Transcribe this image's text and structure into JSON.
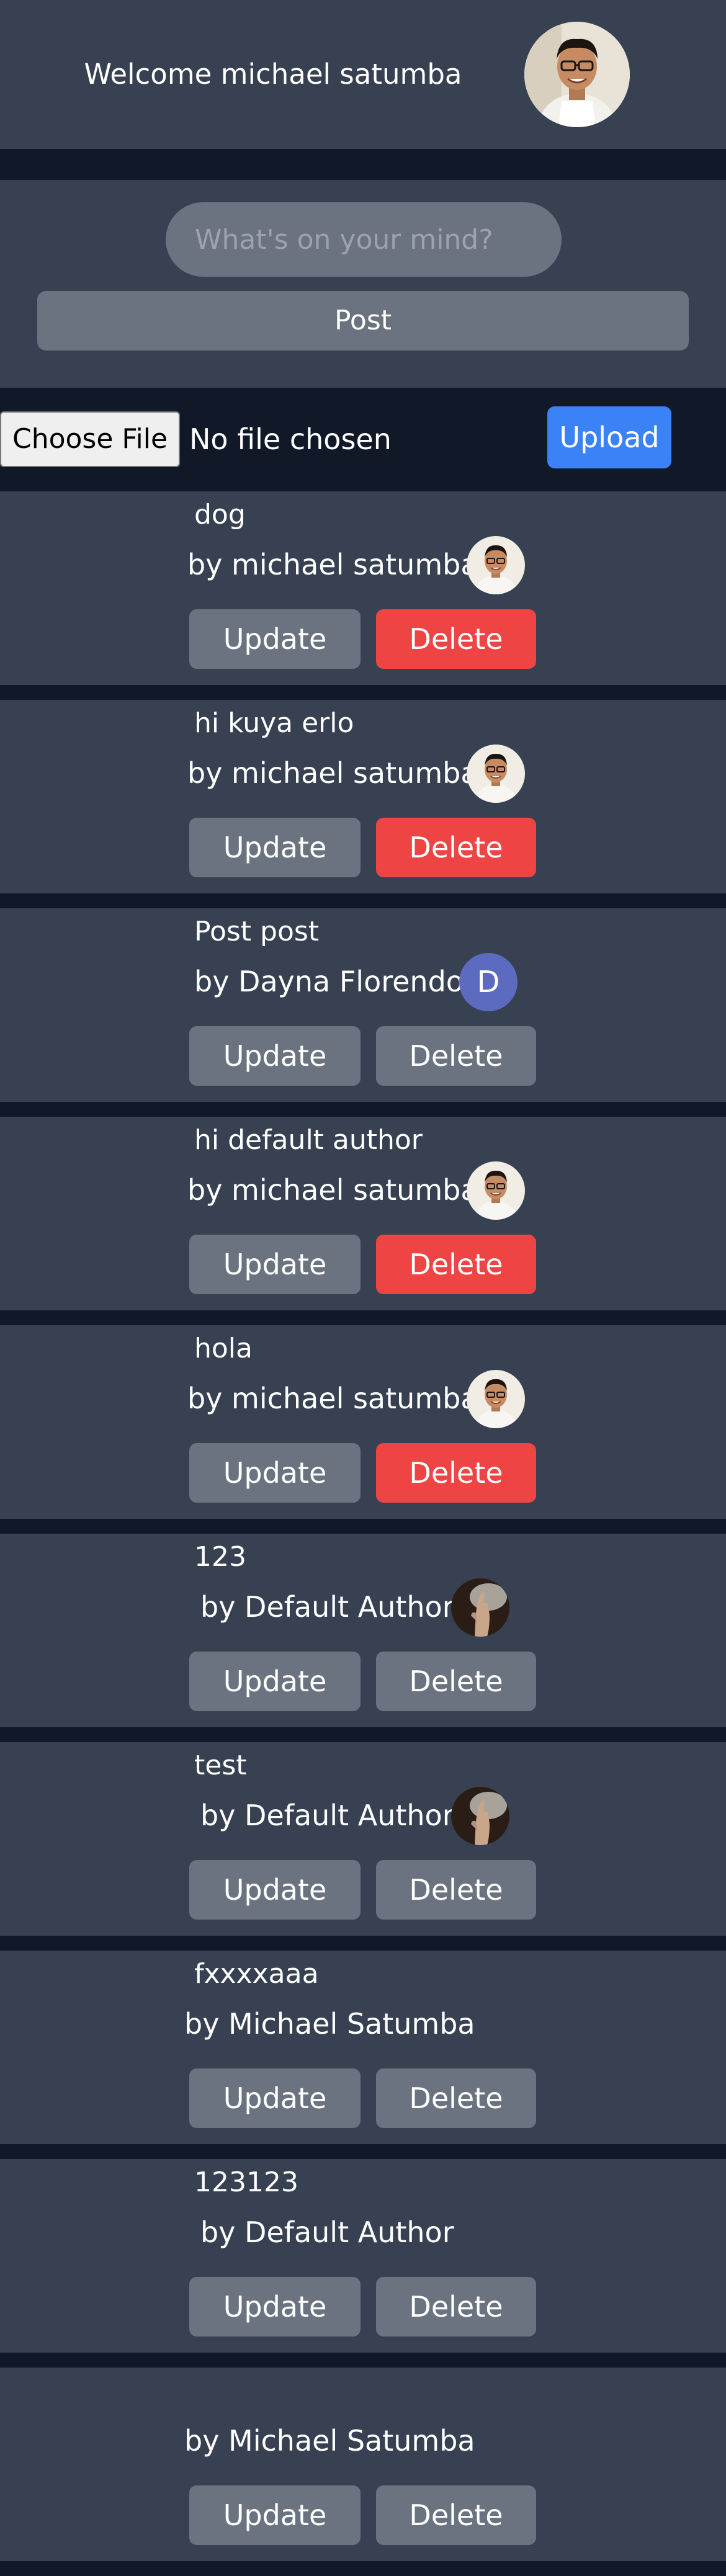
{
  "header": {
    "welcome_text": "Welcome michael satumba",
    "avatar_icon": "user-photo"
  },
  "composer": {
    "placeholder": "What's on your mind?",
    "value": "",
    "post_label": "Post"
  },
  "upload": {
    "choose_label": "Choose File",
    "file_status": "No file chosen",
    "upload_label": "Upload"
  },
  "buttons": {
    "update_label": "Update",
    "delete_label": "Delete"
  },
  "colors": {
    "delete_active": "#ef4444",
    "delete_inactive": "#6b7280",
    "upload": "#3b82f6",
    "initial_avatar": "#5c6bc0"
  },
  "posts": [
    {
      "title": "dog",
      "author": "by michael satumba",
      "avatar": "michael-photo",
      "delete_style": "red"
    },
    {
      "title": "hi kuya erlo",
      "author": "by michael satumba",
      "avatar": "michael-photo",
      "delete_style": "red"
    },
    {
      "title": "Post post",
      "author": "by Dayna Florendo",
      "avatar": "initial",
      "avatar_letter": "D",
      "delete_style": "gray"
    },
    {
      "title": "hi default author",
      "author": "by michael satumba",
      "avatar": "michael-photo",
      "delete_style": "red"
    },
    {
      "title": "hola",
      "author": "by michael satumba",
      "avatar": "michael-photo",
      "delete_style": "red"
    },
    {
      "title": "123",
      "author": "by Default Author",
      "avatar": "hand-photo",
      "delete_style": "gray"
    },
    {
      "title": "test",
      "author": "by Default Author",
      "avatar": "hand-photo",
      "delete_style": "gray"
    },
    {
      "title": "fxxxxaaa",
      "author": "by Michael Satumba",
      "avatar": "none",
      "delete_style": "gray"
    },
    {
      "title": "123123",
      "author": "by Default Author",
      "avatar": "none",
      "delete_style": "gray"
    },
    {
      "title": "",
      "author": "by Michael Satumba",
      "avatar": "none",
      "delete_style": "gray"
    }
  ]
}
